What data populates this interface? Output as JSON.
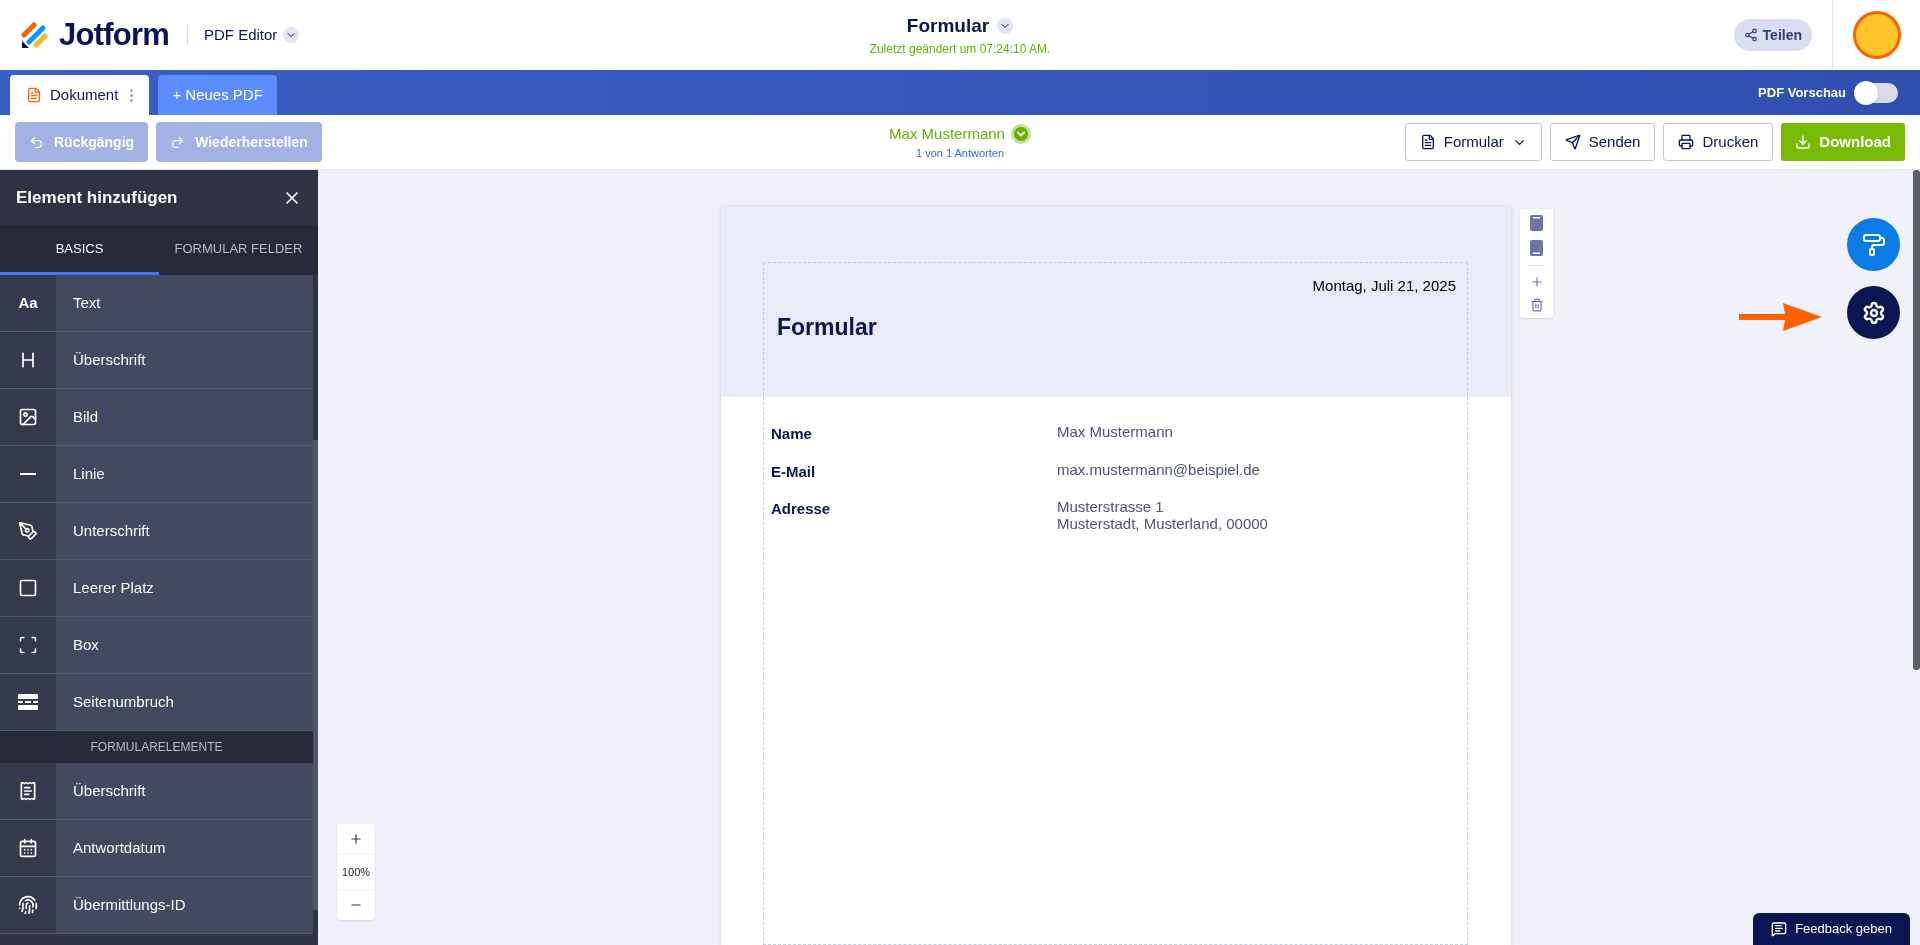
{
  "header": {
    "logo": "Jotform",
    "product": "PDF Editor",
    "title": "Formular",
    "saved": "Zuletzt geändert um 07:24:10 AM.",
    "share": "Teilen"
  },
  "doc_tabs": [
    {
      "label": "Dokument",
      "selected": true
    }
  ],
  "new_pdf": "+ Neues PDF",
  "pdf_preview": {
    "label": "PDF Vorschau",
    "on": false
  },
  "toolbar": {
    "undo": {
      "label": "Rückgängig",
      "disabled": true
    },
    "redo": {
      "label": "Wiederherstellen",
      "disabled": true
    },
    "submission": {
      "name": "Max Mustermann",
      "count": "1 von 1 Antworten"
    },
    "actions": [
      {
        "kind": "form",
        "label": "Formular"
      },
      {
        "kind": "send",
        "label": "Senden"
      },
      {
        "kind": "print",
        "label": "Drucken"
      },
      {
        "kind": "download",
        "label": "Download"
      }
    ]
  },
  "sidebar": {
    "title": "Element hinzufügen",
    "tabs": [
      {
        "label": "BASICS",
        "selected": true
      },
      {
        "label": "FORMULAR FELDER",
        "selected": false
      }
    ],
    "sections": [
      {
        "items": [
          {
            "kind": "text",
            "icon_text": "Aa",
            "label": "Text"
          },
          {
            "kind": "heading",
            "label": "Überschrift"
          },
          {
            "kind": "image",
            "label": "Bild"
          },
          {
            "kind": "line",
            "label": "Linie"
          },
          {
            "kind": "signature",
            "label": "Unterschrift"
          },
          {
            "kind": "blank",
            "label": "Leerer Platz"
          },
          {
            "kind": "box",
            "label": "Box"
          },
          {
            "kind": "pagebreak",
            "label": "Seitenumbruch"
          }
        ]
      },
      {
        "heading": "FORMULARELEMENTE",
        "items": [
          {
            "kind": "formheader",
            "label": "Überschrift"
          },
          {
            "kind": "date",
            "label": "Antwortdatum"
          },
          {
            "kind": "id",
            "label": "Übermittlungs-ID"
          }
        ]
      }
    ]
  },
  "document": {
    "date": "Montag, Juli 21, 2025",
    "title": "Formular",
    "fields": [
      {
        "label": "Name",
        "lines": [
          "Max Mustermann"
        ]
      },
      {
        "label": "E-Mail",
        "lines": [
          "max.mustermann@beispiel.de"
        ]
      },
      {
        "label": "Adresse",
        "lines": [
          "Musterstrasse 1",
          "Musterstadt, Musterland, 00000"
        ]
      }
    ]
  },
  "zoom": "100%",
  "feedback": "Feedback geben"
}
